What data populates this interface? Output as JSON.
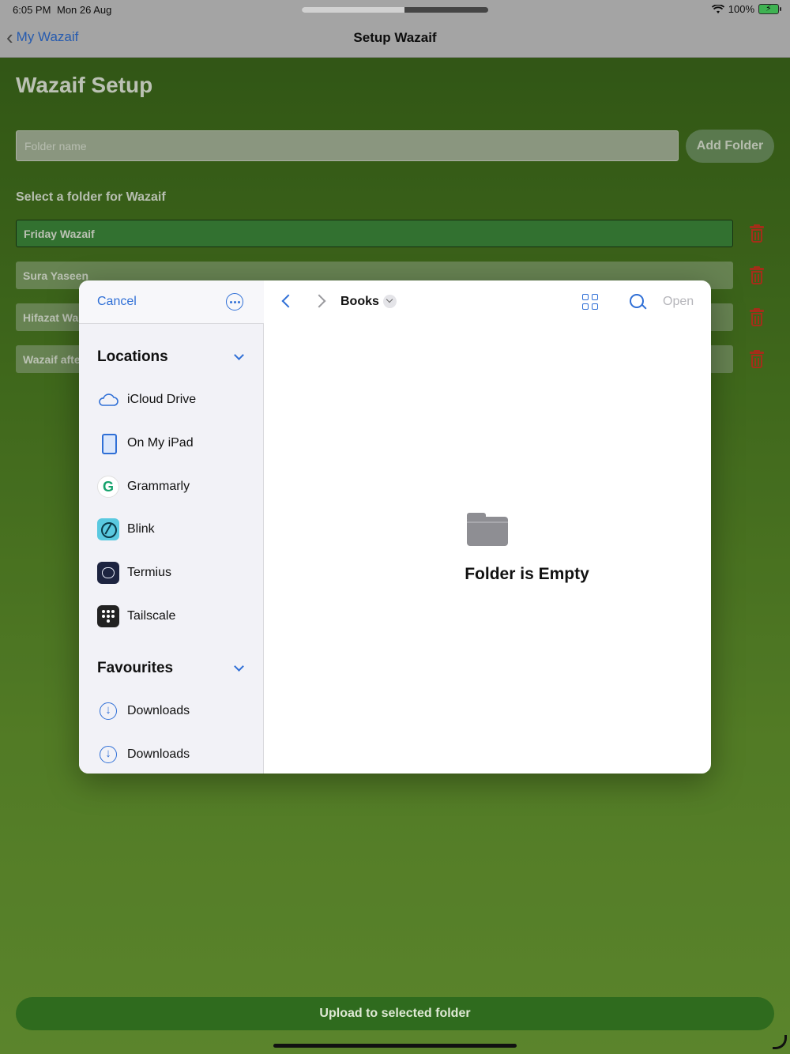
{
  "status_bar": {
    "time": "6:05 PM",
    "date": "Mon 26 Aug",
    "battery_text": "100%",
    "multitask_progress": 0.55
  },
  "nav": {
    "back_label": "My Wazaif",
    "title": "Setup Wazaif"
  },
  "main": {
    "page_title": "Wazaif Setup",
    "folder_input_placeholder": "Folder name",
    "folder_input_value": "",
    "add_folder_label": "Add Folder",
    "select_label": "Select a folder for Wazaif",
    "folders": [
      {
        "name": "Friday Wazaif",
        "selected": true
      },
      {
        "name": "Sura Yaseen",
        "selected": false
      },
      {
        "name": "Hifazat Wa",
        "selected": false
      },
      {
        "name": "Wazaif afte",
        "selected": false
      }
    ],
    "upload_label": "Upload to selected folder"
  },
  "picker": {
    "cancel_label": "Cancel",
    "locations_title": "Locations",
    "locations": [
      {
        "label": "iCloud Drive",
        "icon": "icloud-icon"
      },
      {
        "label": "On My iPad",
        "icon": "ipad-icon"
      },
      {
        "label": "Grammarly",
        "icon": "grammarly-icon"
      },
      {
        "label": "Blink",
        "icon": "blink-icon"
      },
      {
        "label": "Termius",
        "icon": "termius-icon"
      },
      {
        "label": "Tailscale",
        "icon": "tailscale-icon"
      }
    ],
    "favourites_title": "Favourites",
    "favourites": [
      {
        "label": "Downloads",
        "icon": "download-icon"
      },
      {
        "label": "Downloads",
        "icon": "download-icon"
      }
    ],
    "folder_title": "Books",
    "open_label": "Open",
    "empty_text": "Folder is Empty",
    "grammarly_glyph": "G"
  },
  "colors": {
    "accent": "#2f6fd6",
    "delete": "#c8391f",
    "selected_row": "#3d8a3b",
    "upload_button": "#2f6b1e"
  }
}
